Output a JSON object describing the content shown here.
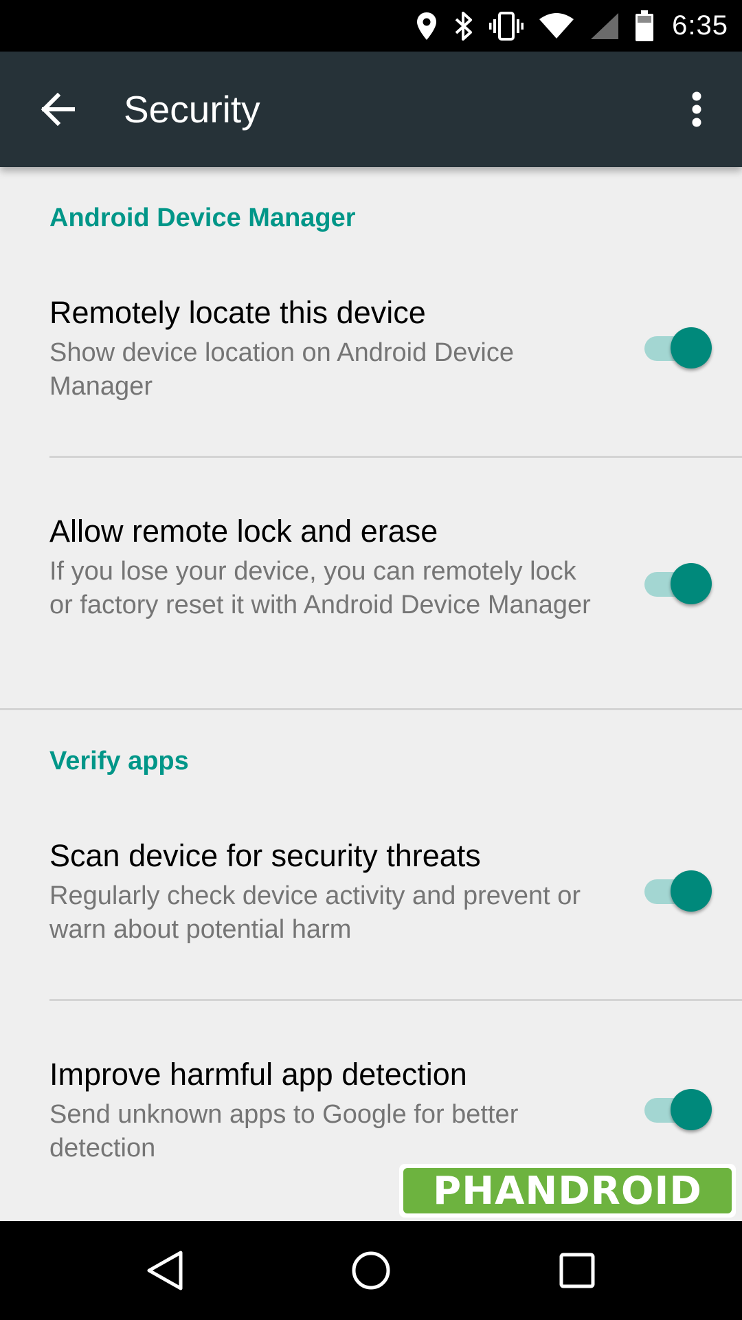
{
  "status_bar": {
    "time": "6:35",
    "icons": [
      "location-icon",
      "bluetooth-icon",
      "vibrate-icon",
      "wifi-icon",
      "signal-icon",
      "battery-icon"
    ]
  },
  "app_bar": {
    "title": "Security",
    "back_icon": "arrow-back-icon",
    "overflow_icon": "more-vert-icon"
  },
  "sections": [
    {
      "header": "Android Device Manager",
      "items": [
        {
          "title": "Remotely locate this device",
          "summary": "Show device location on Android Device Manager",
          "enabled": true
        },
        {
          "title": "Allow remote lock and erase",
          "summary": "If you lose your device, you can remotely lock or factory reset it with Android Device Manager",
          "enabled": true
        }
      ]
    },
    {
      "header": "Verify apps",
      "items": [
        {
          "title": "Scan device for security threats",
          "summary": "Regularly check device activity and prevent or warn about potential harm",
          "enabled": true
        },
        {
          "title": "Improve harmful app detection",
          "summary": "Send unknown apps to Google for better detection",
          "enabled": true
        }
      ]
    }
  ],
  "watermark": "PHANDROID",
  "colors": {
    "accent": "#009688",
    "switch_thumb": "#00897b",
    "switch_track": "#a3d6d2",
    "app_bar": "#263238",
    "background": "#efefef"
  },
  "nav_bar": {
    "icons": [
      "nav-back-icon",
      "nav-home-icon",
      "nav-recents-icon"
    ]
  }
}
